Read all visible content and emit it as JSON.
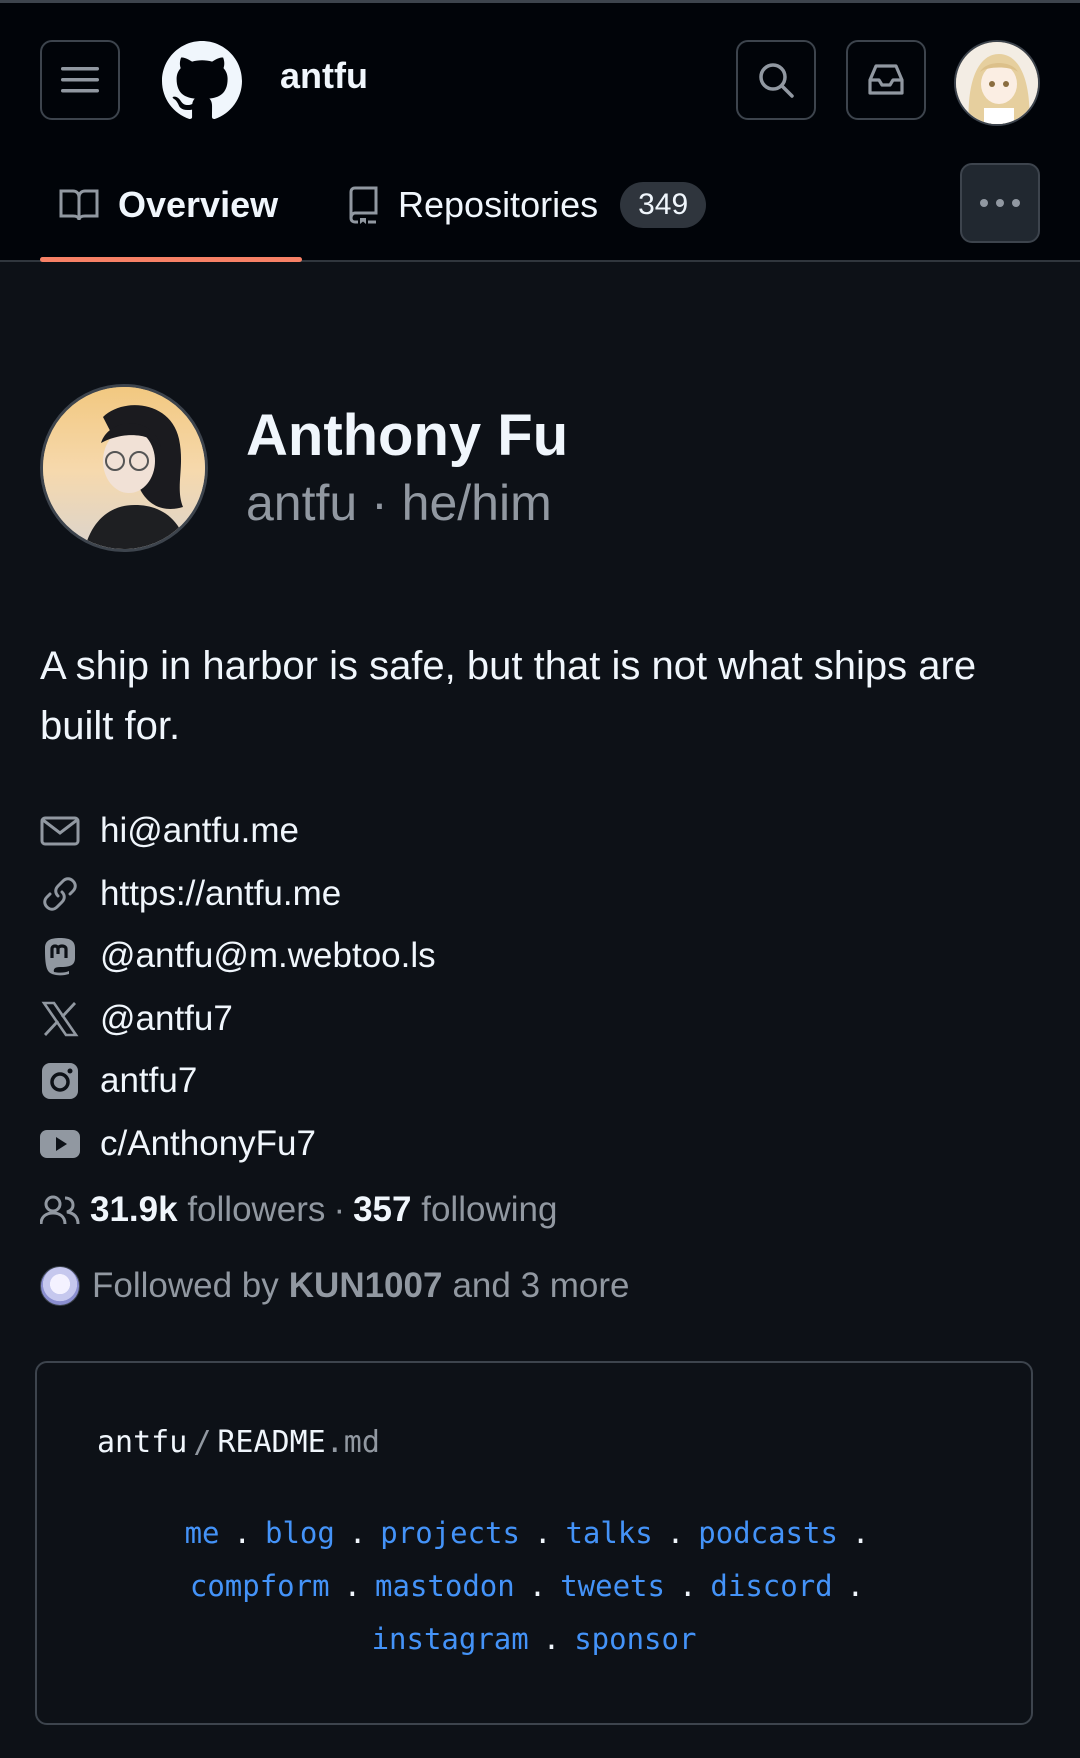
{
  "header": {
    "owner": "antfu",
    "tabs": {
      "overview": "Overview",
      "repositories": "Repositories",
      "repositories_count": "349"
    }
  },
  "profile": {
    "name": "Anthony Fu",
    "login_line": "antfu · he/him",
    "bio": "A ship in harbor is safe, but that is not what ships are built for.",
    "links": [
      {
        "icon": "mail-icon",
        "text": "hi@antfu.me"
      },
      {
        "icon": "link-icon",
        "text": "https://antfu.me"
      },
      {
        "icon": "mastodon-icon",
        "text": "@antfu@m.webtoo.ls"
      },
      {
        "icon": "x-icon",
        "text": "@antfu7"
      },
      {
        "icon": "instagram-icon",
        "text": "antfu7"
      },
      {
        "icon": "youtube-icon",
        "text": "c/AnthonyFu7"
      }
    ],
    "followers_count": "31.9k",
    "followers_label": "followers",
    "separator": "·",
    "following_count": "357",
    "following_label": "following",
    "followed_by_prefix": "Followed by",
    "followed_by_user": "KUN1007",
    "followed_by_suffix": "and 3 more"
  },
  "readme": {
    "owner": "antfu",
    "slash": "/",
    "file_base": "README",
    "file_ext": ".md",
    "links_row1": [
      "me",
      "blog",
      "projects",
      "talks",
      "podcasts"
    ],
    "links_row2": [
      "compform",
      "mastodon",
      "tweets",
      "discord"
    ],
    "links_row3": [
      "instagram",
      "sponsor"
    ],
    "dot": "."
  },
  "colors": {
    "background": "#0d1117",
    "appbar": "#010409",
    "accent_underline": "#f78166",
    "link_blue": "#4493f8",
    "muted": "#9198a1"
  }
}
